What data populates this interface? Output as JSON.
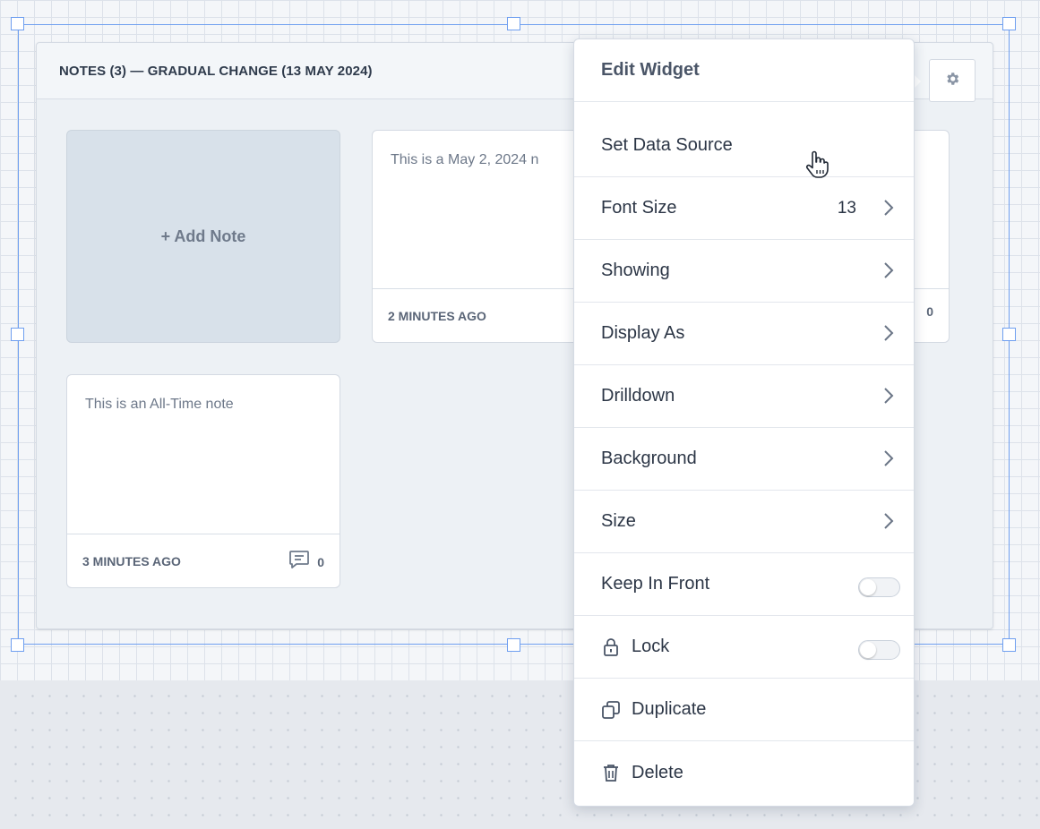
{
  "widget": {
    "title": "NOTES (3) — GRADUAL CHANGE (13 MAY 2024)"
  },
  "add_note": {
    "label": "+ Add Note"
  },
  "notes": [
    {
      "text": "This is a May 2, 2024 n",
      "time": "2 MINUTES AGO",
      "comments": "0"
    },
    {
      "text": "This is an All-Time note",
      "time": "3 MINUTES AGO",
      "comments": "0"
    }
  ],
  "menu": {
    "header": "Edit Widget",
    "items": [
      {
        "label": "Set Data Source"
      },
      {
        "label": "Font Size",
        "value": "13"
      },
      {
        "label": "Showing"
      },
      {
        "label": "Display As"
      },
      {
        "label": "Drilldown"
      },
      {
        "label": "Background"
      },
      {
        "label": "Size"
      },
      {
        "label": "Keep In Front",
        "toggle": false
      },
      {
        "label": "Lock",
        "toggle": false,
        "icon": "lock-icon"
      },
      {
        "label": "Duplicate",
        "icon": "duplicate-icon"
      },
      {
        "label": "Delete",
        "icon": "trash-icon"
      }
    ]
  },
  "colors": {
    "selection": "#6f9ff0",
    "widget_bg": "#edf1f5",
    "add_note_bg": "#d8e1ea",
    "text_dark": "#2c3646",
    "text_muted": "#6d7889"
  }
}
